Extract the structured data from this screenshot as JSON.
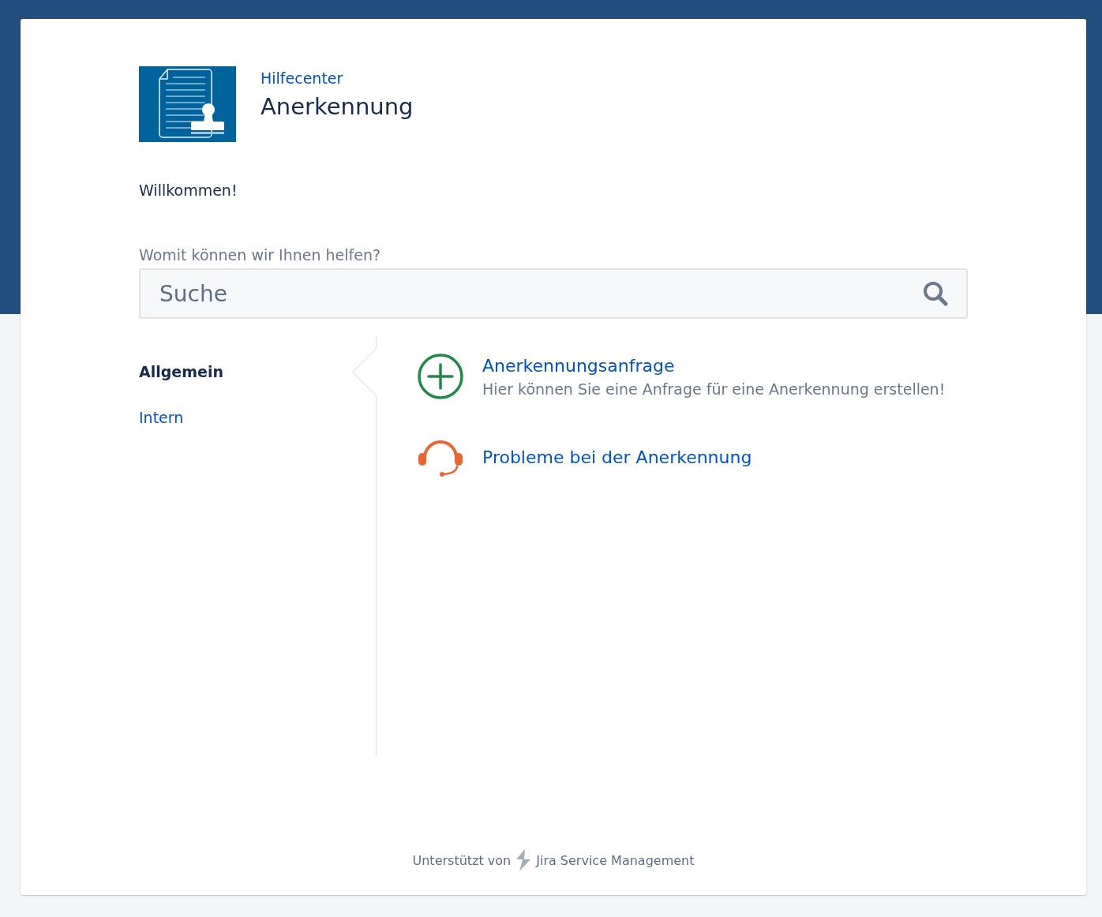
{
  "header": {
    "breadcrumb": "Hilfecenter",
    "title": "Anerkennung"
  },
  "welcome": "Willkommen!",
  "search": {
    "label": "Womit können wir Ihnen helfen?",
    "placeholder": "Suche"
  },
  "groups": [
    {
      "label": "Allgemein",
      "selected": true
    },
    {
      "label": "Intern",
      "selected": false
    }
  ],
  "request_types": [
    {
      "kind": "plus",
      "title": "Anerkennungsanfrage",
      "description": "Hier können Sie eine Anfrage für eine Anerkennung erstellen!"
    },
    {
      "kind": "headset",
      "title": "Probleme bei der Anerkennung"
    }
  ],
  "footer": {
    "prefix": "Unterstützt von",
    "product": "Jira Service Management"
  }
}
